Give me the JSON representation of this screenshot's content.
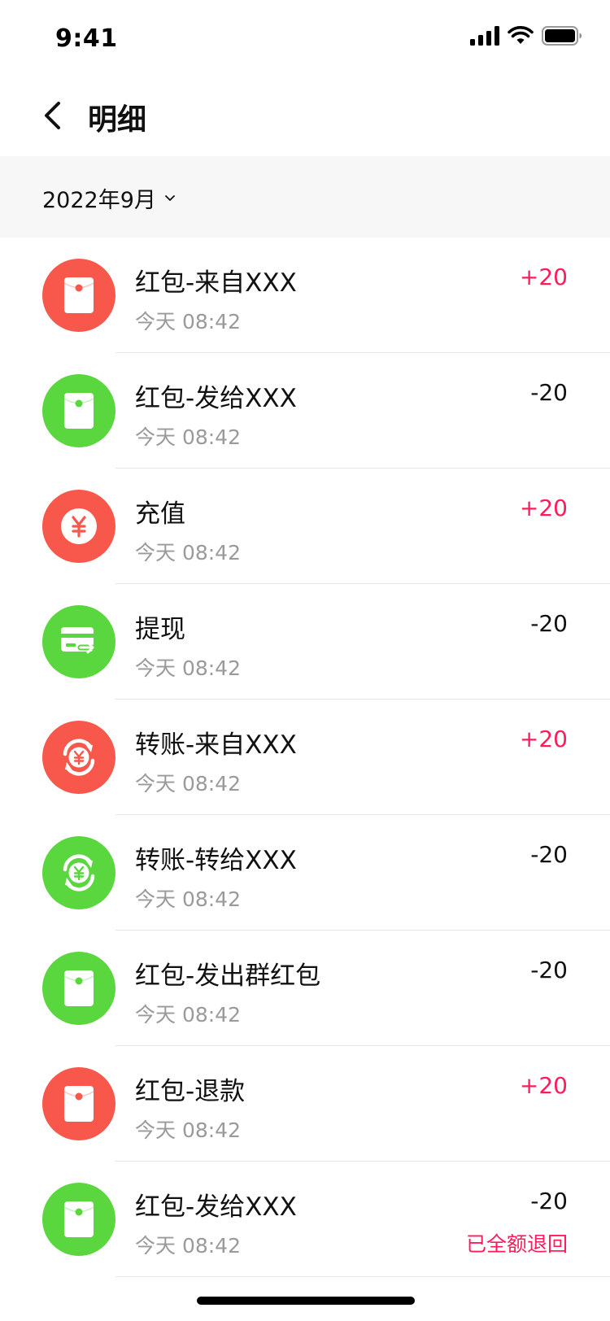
{
  "status_bar": {
    "time": "9:41"
  },
  "header": {
    "title": "明细"
  },
  "filter": {
    "month": "2022年9月"
  },
  "transactions": [
    {
      "title": "红包-来自XXX",
      "time": "今天 08:42",
      "amount": "+20",
      "icon": "red-envelope-icon",
      "color": "#f8574c"
    },
    {
      "title": "红包-发给XXX",
      "time": "今天 08:42",
      "amount": "-20",
      "icon": "red-envelope-icon",
      "color": "#5ad63e"
    },
    {
      "title": "充值",
      "time": "今天 08:42",
      "amount": "+20",
      "icon": "yuan-coin-icon",
      "color": "#f8574c"
    },
    {
      "title": "提现",
      "time": "今天 08:42",
      "amount": "-20",
      "icon": "withdraw-card-icon",
      "color": "#5ad63e"
    },
    {
      "title": "转账-来自XXX",
      "time": "今天 08:42",
      "amount": "+20",
      "icon": "transfer-yuan-icon",
      "color": "#f8574c"
    },
    {
      "title": "转账-转给XXX",
      "time": "今天 08:42",
      "amount": "-20",
      "icon": "transfer-yuan-icon",
      "color": "#5ad63e"
    },
    {
      "title": "红包-发出群红包",
      "time": "今天 08:42",
      "amount": "-20",
      "icon": "red-envelope-icon",
      "color": "#5ad63e"
    },
    {
      "title": "红包-退款",
      "time": "今天 08:42",
      "amount": "+20",
      "icon": "red-envelope-icon",
      "color": "#f8574c"
    },
    {
      "title": "红包-发给XXX",
      "time": "今天 08:42",
      "amount": "-20",
      "icon": "red-envelope-icon",
      "color": "#5ad63e",
      "note": "已全额退回"
    }
  ]
}
